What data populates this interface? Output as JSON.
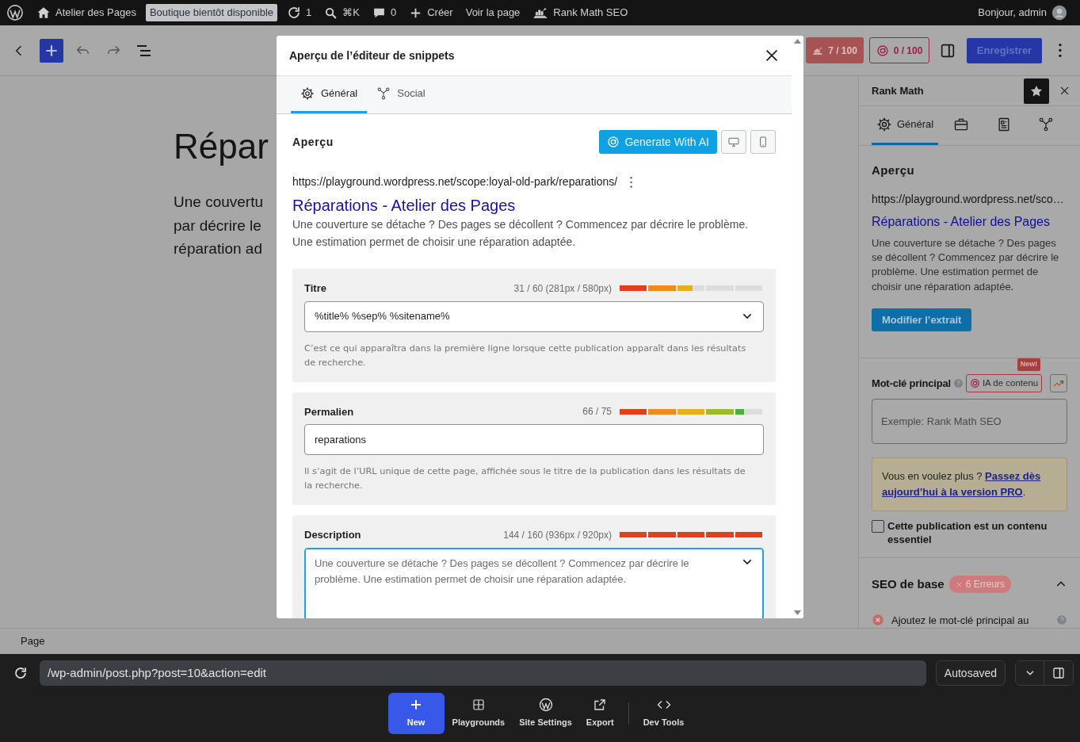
{
  "admin_bar": {
    "site": "Atelier des Pages",
    "badge": "Boutique bientôt disponible",
    "updates": "1",
    "search_shortcut": "⌘K",
    "comments": "0",
    "create": "Créer",
    "view": "Voir la page",
    "plugin": "Rank Math SEO",
    "greeting": "Bonjour, admin"
  },
  "editor_toolbar": {
    "seo_score": "7 / 100",
    "ai_score": "0 / 100",
    "save": "Enregistrer"
  },
  "editor_content": {
    "title": "Répar",
    "paragraph_lines": [
      "Une couvertu",
      "par décrire le",
      "réparation ad"
    ]
  },
  "footer": {
    "breadcrumb": "Page"
  },
  "modal": {
    "title": "Aperçu de l’éditeur de snippets",
    "tabs": [
      {
        "label": "Général",
        "selected": true
      },
      {
        "label": "Social",
        "selected": false
      }
    ],
    "preview": {
      "heading": "Aperçu",
      "ai_button": "Generate With AI",
      "url": "https://playground.wordpress.net/scope:loyal-old-park/reparations/",
      "link_title": "Réparations - Atelier des Pages",
      "description": "Une couverture se détache ? Des pages se décollent ? Commencez par décrire le problème. Une estimation permet de choisir une réparation adaptée."
    },
    "fields": [
      {
        "kind": "select",
        "label": "Titre",
        "counter": "31 / 60 (281px / 580px)",
        "level": 0.51,
        "over_limit": false,
        "value": "%title% %sep% %sitename%",
        "help": "C’est ce qui apparaîtra dans la première ligne lorsque cette publication apparaît dans les résultats de recherche."
      },
      {
        "kind": "input",
        "label": "Permalien",
        "counter": "66 / 75",
        "level": 0.87,
        "over_limit": false,
        "value": "reparations",
        "help": "Il s’agit de l’URL unique de cette page, affichée sous le titre de la publication dans les résultats de la recherche."
      },
      {
        "kind": "textarea",
        "label": "Description",
        "counter": "144 / 160 (936px / 920px)",
        "level": 1,
        "over_limit": true,
        "focused": true,
        "placeholder": "Une couverture se détache ? Des pages se décollent ? Commencez par décrire le problème. Une estimation permet de choisir une réparation adaptée."
      }
    ]
  },
  "sidebar": {
    "title": "Rank Math",
    "tabs": [
      {
        "label": "Général",
        "selected": true
      },
      {
        "selected": false
      },
      {
        "selected": false
      },
      {
        "selected": false
      }
    ],
    "preview": {
      "heading": "Aperçu",
      "url": "https://playground.wordpress.net/sco…",
      "link_title": "Réparations - Atelier des Pages",
      "description": "Une couverture se détache ? Des pages se décollent ? Commencez par décrire le problème. Une estimation permet de choisir une réparation adaptée.",
      "edit_button": "Modifier l’extrait"
    },
    "keyword": {
      "label": "Mot-clé principal",
      "ai_button": "IA de contenu",
      "new_badge": "New!",
      "placeholder": "Exemple: Rank Math SEO"
    },
    "upgrade": {
      "text": "Vous en voulez plus ?",
      "link": "Passez dès aujourd’hui à la version PRO",
      "suffix": "."
    },
    "pillar": {
      "label": "Cette publication est un contenu essentiel",
      "checked": false
    },
    "seo_section": {
      "title": "SEO de base",
      "error_badge": "6 Erreurs",
      "expanded": true,
      "items": [
        {
          "text": "Ajoutez le mot-clé principal au"
        }
      ]
    }
  },
  "playground": {
    "url": "/wp-admin/post.php?post=10&action=edit",
    "status": "Autosaved",
    "actions": [
      {
        "label": "New",
        "primary": true
      },
      {
        "label": "Playgrounds",
        "primary": false
      },
      {
        "label": "Site Settings",
        "primary": false
      },
      {
        "label": "Export",
        "primary": false
      },
      {
        "label": "Dev Tools",
        "primary": false
      }
    ]
  }
}
